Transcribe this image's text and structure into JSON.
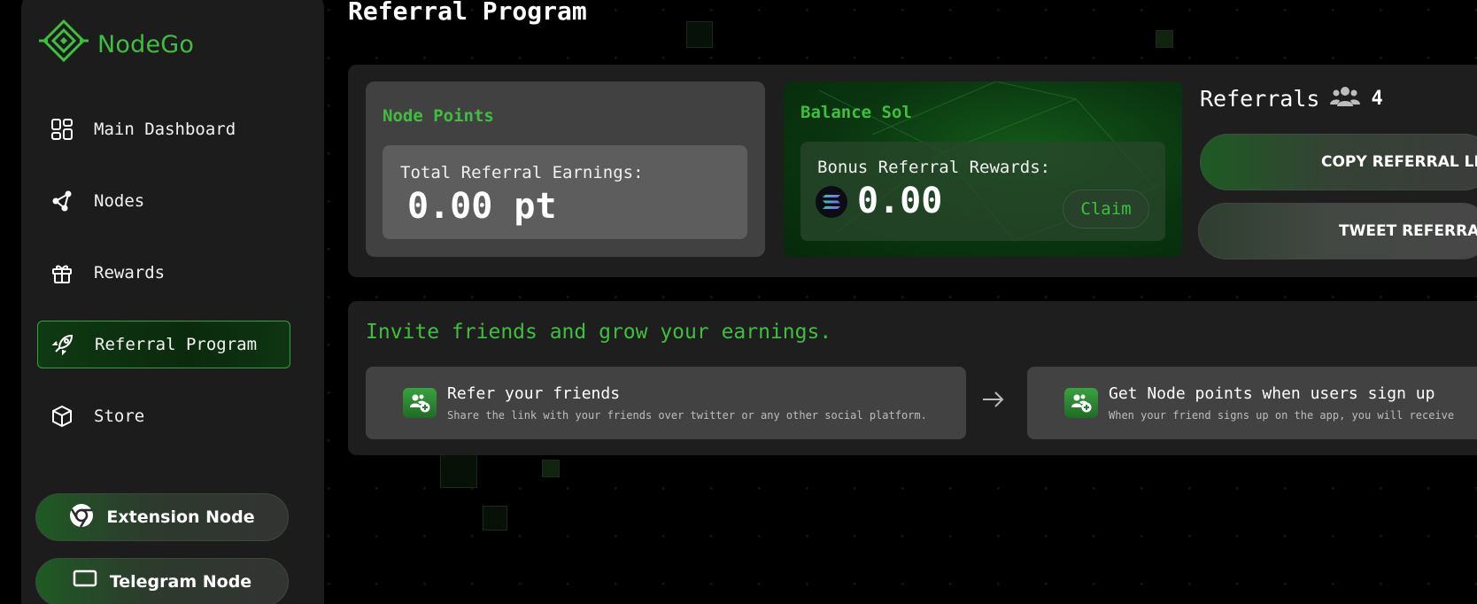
{
  "brand": {
    "name": "NodeGo"
  },
  "sidebar": {
    "items": [
      {
        "label": "Main Dashboard",
        "icon": "dashboard-grid-icon"
      },
      {
        "label": "Nodes",
        "icon": "nodes-share-icon"
      },
      {
        "label": "Rewards",
        "icon": "gift-icon"
      },
      {
        "label": "Referral Program",
        "icon": "rocket-icon",
        "active": true
      },
      {
        "label": "Store",
        "icon": "box-icon"
      }
    ],
    "buttons": [
      {
        "label": "Extension Node",
        "icon": "chrome-icon"
      },
      {
        "label": "Telegram Node",
        "icon": "monitor-icon"
      }
    ]
  },
  "page": {
    "title": "Referral Program"
  },
  "node_points": {
    "title": "Node Points",
    "subtitle": "Total Referral Earnings:",
    "value": "0.00 pt"
  },
  "balance_sol": {
    "title": "Balance Sol",
    "subtitle": "Bonus Referral Rewards:",
    "value": "0.00",
    "claim_label": "Claim"
  },
  "referrals": {
    "title": "Referrals",
    "count": "4",
    "copy_label": "COPY REFERRAL LINK",
    "tweet_label": "TWEET REFERRAL"
  },
  "invite": {
    "title": "Invite friends and grow your earnings.",
    "steps": [
      {
        "title": "Refer your friends",
        "desc": "Share the link with your friends over twitter or any other social platform."
      },
      {
        "title": "Get Node points when users sign up",
        "desc": "When your friend signs up on the app, you will receive"
      }
    ]
  },
  "colors": {
    "accent": "#3fbf3f",
    "background": "#000000",
    "panel": "#1e1e1e"
  }
}
